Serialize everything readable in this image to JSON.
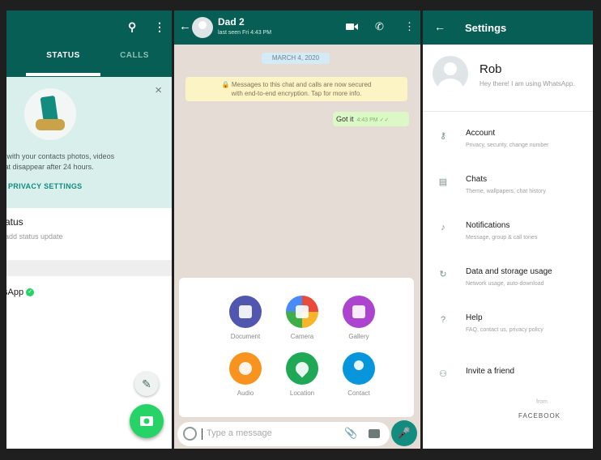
{
  "status_screen": {
    "tabs": [
      "STATUS",
      "CALLS"
    ],
    "close_glyph": "×",
    "promo_text_1": "re with your contacts photos, videos",
    "promo_text_2": "that disappear after 24 hours.",
    "privacy_settings": "PRIVACY SETTINGS",
    "my_status_title": "atus",
    "my_status_sub": "add status update",
    "whatsapp_label": "sApp",
    "verified_glyph": "✓"
  },
  "chat_screen": {
    "contact_name": "Dad 2",
    "last_seen": "last seen Fri 4:43 PM",
    "date_pill": "MARCH 4, 2020",
    "encryption_line1": "🔒 Messages to this chat and calls are now secured",
    "encryption_line2": "with end-to-end encryption. Tap for more info.",
    "message_text": "Got it",
    "message_time": "4:43 PM ✓✓",
    "attach_options": [
      {
        "label": "Document",
        "color": "#5157ae"
      },
      {
        "label": "Camera",
        "color": "#d3396d"
      },
      {
        "label": "Gallery",
        "color": "#ac44cf"
      },
      {
        "label": "Audio",
        "color": "#f7931e"
      },
      {
        "label": "Location",
        "color": "#1fa855"
      },
      {
        "label": "Contact",
        "color": "#0795dc"
      }
    ],
    "input_placeholder": "Type a message",
    "clip_glyph": "📎",
    "mic_glyph": "🎤"
  },
  "settings_screen": {
    "title": "Settings",
    "profile_name": "Rob",
    "profile_about": "Hey there! I am using WhatsApp.",
    "items": [
      {
        "title": "Account",
        "sub": "Privacy, security, change number"
      },
      {
        "title": "Chats",
        "sub": "Theme, wallpapers, chat history"
      },
      {
        "title": "Notifications",
        "sub": "Message, group & call tones"
      },
      {
        "title": "Data and storage usage",
        "sub": "Network usage, auto-download"
      },
      {
        "title": "Help",
        "sub": "FAQ, contact us, privacy policy"
      },
      {
        "title": "Invite a friend",
        "sub": ""
      }
    ],
    "from_label": "from",
    "facebook_label": "FACEBOOK"
  },
  "colors": {
    "header": "#075e54",
    "accent": "#25d366",
    "teal": "#128c7e",
    "chat_bg": "#e5ddd5",
    "bubble": "#dcf8c6"
  },
  "icons": [
    "back-arrow-icon",
    "search-icon",
    "more-icon",
    "video-call-icon",
    "voice-call-icon",
    "close-icon",
    "pencil-icon",
    "camera-icon",
    "emoji-icon",
    "attach-icon",
    "mic-icon",
    "key-icon",
    "chat-icon",
    "bell-icon",
    "data-icon",
    "help-icon",
    "people-icon"
  ]
}
